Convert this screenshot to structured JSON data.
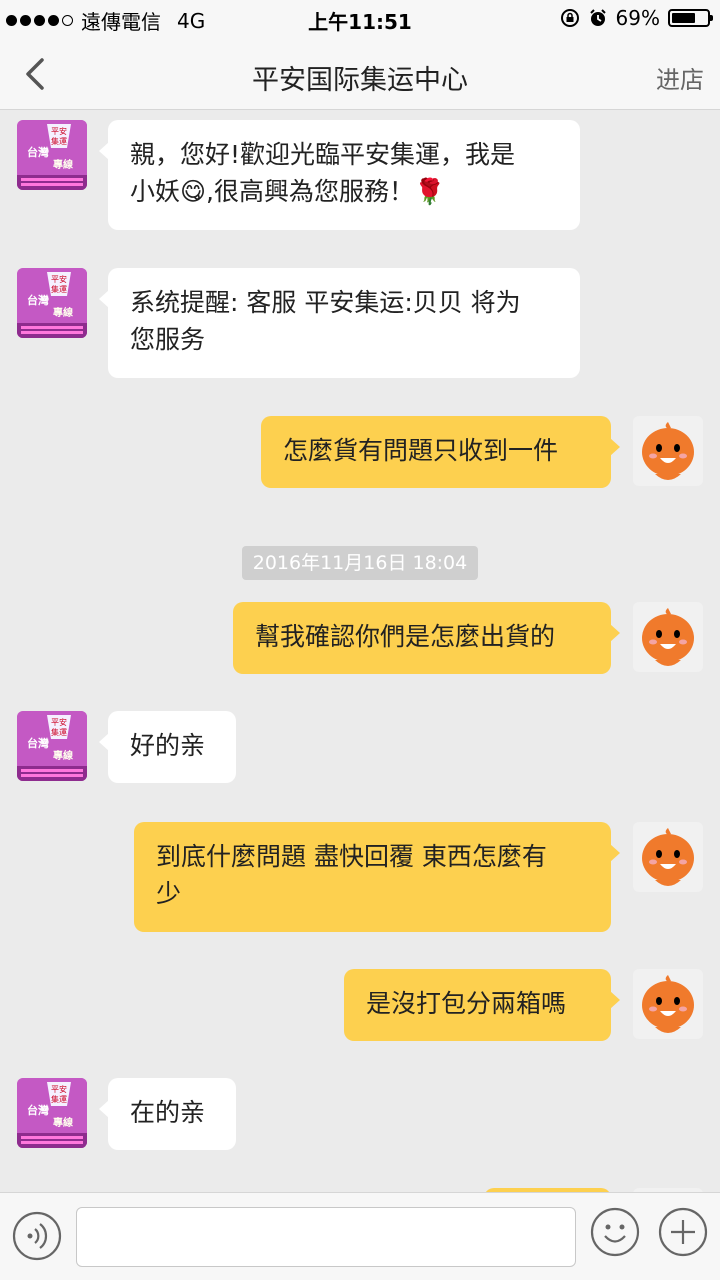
{
  "status_bar": {
    "carrier": "遠傳電信",
    "network": "4G",
    "time": "上午11:51",
    "battery_percent": "69%",
    "battery_level": 0.69
  },
  "nav": {
    "title": "平安国际集运中心",
    "right_label": "进店"
  },
  "messages": [
    {
      "side": "in",
      "text": "親，您好!歡迎光臨平安集運，我是\n小妖😋,很高興為您服務！🌹"
    },
    {
      "side": "in",
      "text": "系统提醒: 客服 平安集运:贝贝 将为\n您服务"
    },
    {
      "side": "out",
      "text": "怎麼貨有問題只收到一件"
    },
    {
      "side": "timestamp",
      "text": "2016年11月16日 18:04"
    },
    {
      "side": "out",
      "text": "幫我確認你們是怎麼出貨的"
    },
    {
      "side": "in",
      "text": "好的亲"
    },
    {
      "side": "out",
      "text": "到底什麼問題 盡快回覆 東西怎麼有\n少"
    },
    {
      "side": "out",
      "text": "是沒打包分兩箱嗎"
    },
    {
      "side": "in",
      "text": "在的亲"
    }
  ],
  "shop_avatar": {
    "lines": [
      "平安",
      "集運",
      "台灣",
      "專線"
    ]
  },
  "input": {
    "placeholder": ""
  },
  "icons": {
    "back": "chevron-left-icon",
    "voice": "voice-icon",
    "emoji": "emoji-icon",
    "plus": "plus-icon"
  }
}
